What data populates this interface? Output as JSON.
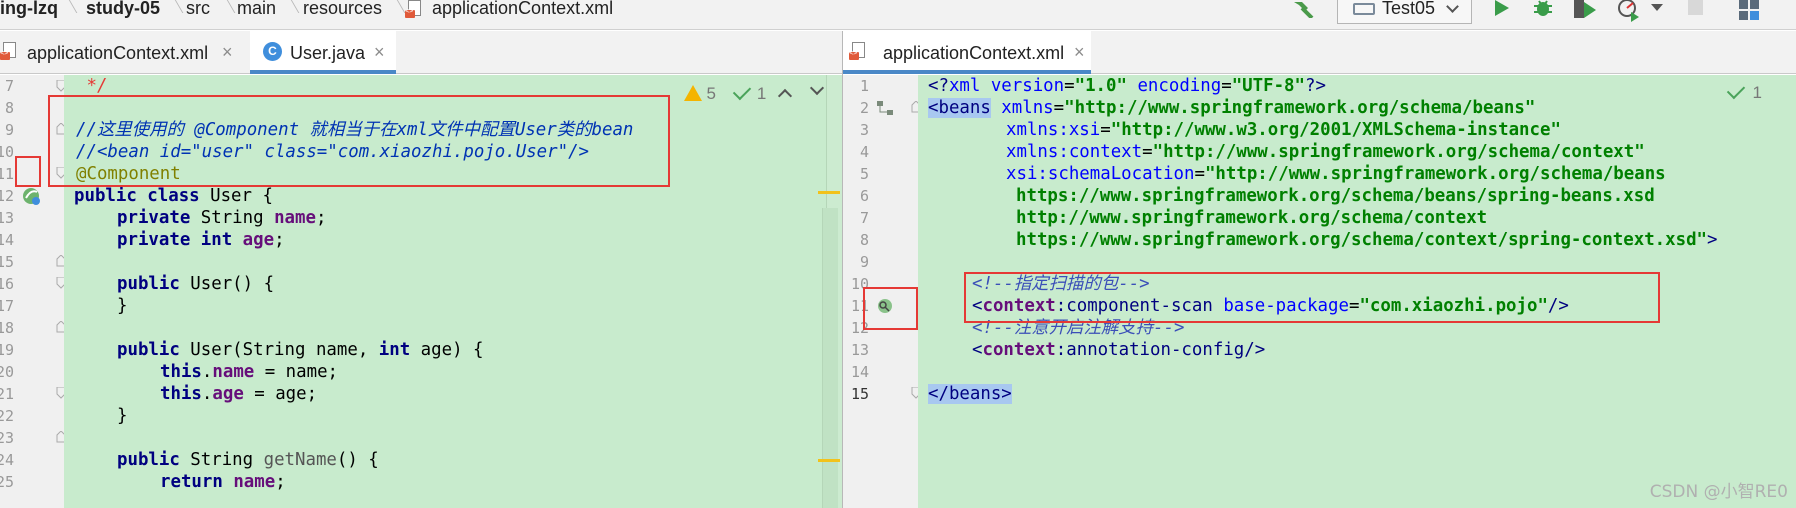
{
  "breadcrumb": {
    "items": [
      "ing-lzq",
      "study-05",
      "src",
      "main",
      "resources",
      "applicationContext.xml"
    ]
  },
  "toolbar": {
    "run_config": "Test05"
  },
  "left_editor": {
    "tabs": [
      {
        "label": "applicationContext.xml",
        "close": "×"
      },
      {
        "label": "User.java",
        "close": "×",
        "icon": "C"
      }
    ],
    "inspections": {
      "warnings": "5",
      "ok": "1"
    },
    "line_numbers": [
      "7",
      "8",
      "9",
      "10",
      "11",
      "12",
      "13",
      "14",
      "15",
      "16",
      "17",
      "18",
      "19",
      "20",
      "21",
      "22",
      "23",
      "24",
      "25"
    ],
    "lines": {
      "l7": " */",
      "l9": "//这里使用的 @Component 就相当于在xml文件中配置User类的bean",
      "l10": "//<bean id=\"user\" class=\"com.xiaozhi.pojo.User\"/>",
      "l11": "@Component",
      "l12_kw": "public class",
      "l12_rest": " User {",
      "l13_kw": "private",
      "l13_type": " String ",
      "l13_fld": "name",
      "l13_end": ";",
      "l14_kw": "private int",
      "l14_fld": "age",
      "l14_end": ";",
      "l16_kw": "public",
      "l16_rest": " User() {",
      "l17": "}",
      "l19_kw": "public",
      "l19_a": " User(String name, ",
      "l19_kw2": "int",
      "l19_b": " age) {",
      "l20_kw": "this",
      "l20_dot": ".",
      "l20_fld": "name",
      "l20_rest": " = name;",
      "l21_kw": "this",
      "l21_dot": ".",
      "l21_fld": "age",
      "l21_rest": " = age;",
      "l22": "}",
      "l24_kw": "public",
      "l24_a": " String ",
      "l24_m": "getName",
      "l24_b": "() {",
      "l25_kw": "return",
      "l25_fld": "name",
      "l25_end": ";"
    }
  },
  "right_editor": {
    "tabs": [
      {
        "label": "applicationContext.xml",
        "close": "×"
      }
    ],
    "inspections": {
      "ok": "1"
    },
    "line_numbers": [
      "1",
      "2",
      "3",
      "4",
      "5",
      "6",
      "7",
      "8",
      "9",
      "10",
      "11",
      "12",
      "13",
      "14",
      "15"
    ],
    "lines": {
      "l1_a": "<?",
      "l1_b": "xml version",
      "l1_c": "=",
      "l1_d": "\"1.0\"",
      "l1_e": " encoding",
      "l1_f": "=",
      "l1_g": "\"UTF-8\"",
      "l1_h": "?>",
      "l2_tag": "<beans",
      "l2_attr": " xmlns",
      "l2_eq": "=",
      "l2_val": "\"http://www.springframework.org/schema/beans\"",
      "l3_ns": "xmlns:xsi",
      "l3_eq": "=",
      "l3_val": "\"http://www.w3.org/2001/XMLSchema-instance\"",
      "l4_ns": "xmlns:context",
      "l4_eq": "=",
      "l4_val": "\"http://www.springframework.org/schema/context\"",
      "l5_ns": "xsi:schemaLocation",
      "l5_eq": "=",
      "l5_val": "\"http://www.springframework.org/schema/beans",
      "l6": "https://www.springframework.org/schema/beans/spring-beans.xsd",
      "l7": "http://www.springframework.org/schema/context",
      "l8_val": "https://www.springframework.org/schema/context/spring-context.xsd\"",
      "l8_end": ">",
      "l10": "<!--指定扫描的包-->",
      "l11_lt": "<",
      "l11_ns": "context",
      "l11_colon": ":component-scan",
      "l11_attr": " base-package",
      "l11_eq": "=",
      "l11_val": "\"com.xiaozhi.pojo\"",
      "l11_end": "/>",
      "l12": "<!--注意开启注解支持-->",
      "l13_lt": "<",
      "l13_ns": "context",
      "l13_rest": ":annotation-config/>",
      "l15": "</beans>"
    }
  },
  "watermark": "CSDN @小智RE0",
  "colors": {
    "code_bg": "#c8ebcd",
    "highlight_box": "#e53935",
    "keyword": "#000080",
    "field": "#660e7a",
    "annotation": "#808000",
    "comment": "#0033b3"
  }
}
